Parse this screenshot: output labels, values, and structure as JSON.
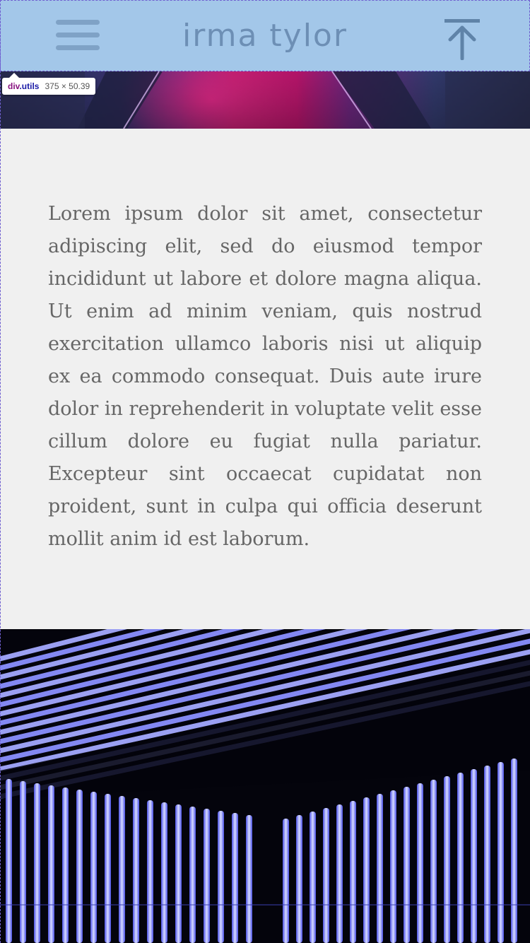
{
  "header": {
    "title": "irma tylor",
    "menu_icon": "hamburger-menu-icon",
    "top_icon": "arrow-up-to-top-icon",
    "background": "#a3c7e9"
  },
  "devtools_tooltip": {
    "tag": "div",
    "class_name": ".utils",
    "dimensions": "375 × 50.39"
  },
  "article": {
    "body": "Lorem ipsum dolor sit amet, consectetur adipiscing elit, sed do eiusmod tempor incididunt ut labore et dolore magna aliqua. Ut enim ad minim veniam, quis nostrud exercitation ullamco laboris nisi ut aliquip ex ea commodo consequat. Duis aute irure dolor in reprehenderit in voluptate velit esse cillum dolore eu fugiat nulla pariatur. Excepteur sint occaecat cupidatat non proident, sunt in culpa qui officia deserunt mollit anim id est laborum."
  },
  "images": {
    "hero": "neon-magenta-corridor-image",
    "bottom": "blue-neon-tubes-image"
  },
  "colors": {
    "page_background": "#f0f0f0",
    "text": "#666666",
    "icon": "#5f83a8",
    "neon_blue": "#7f86ff"
  }
}
